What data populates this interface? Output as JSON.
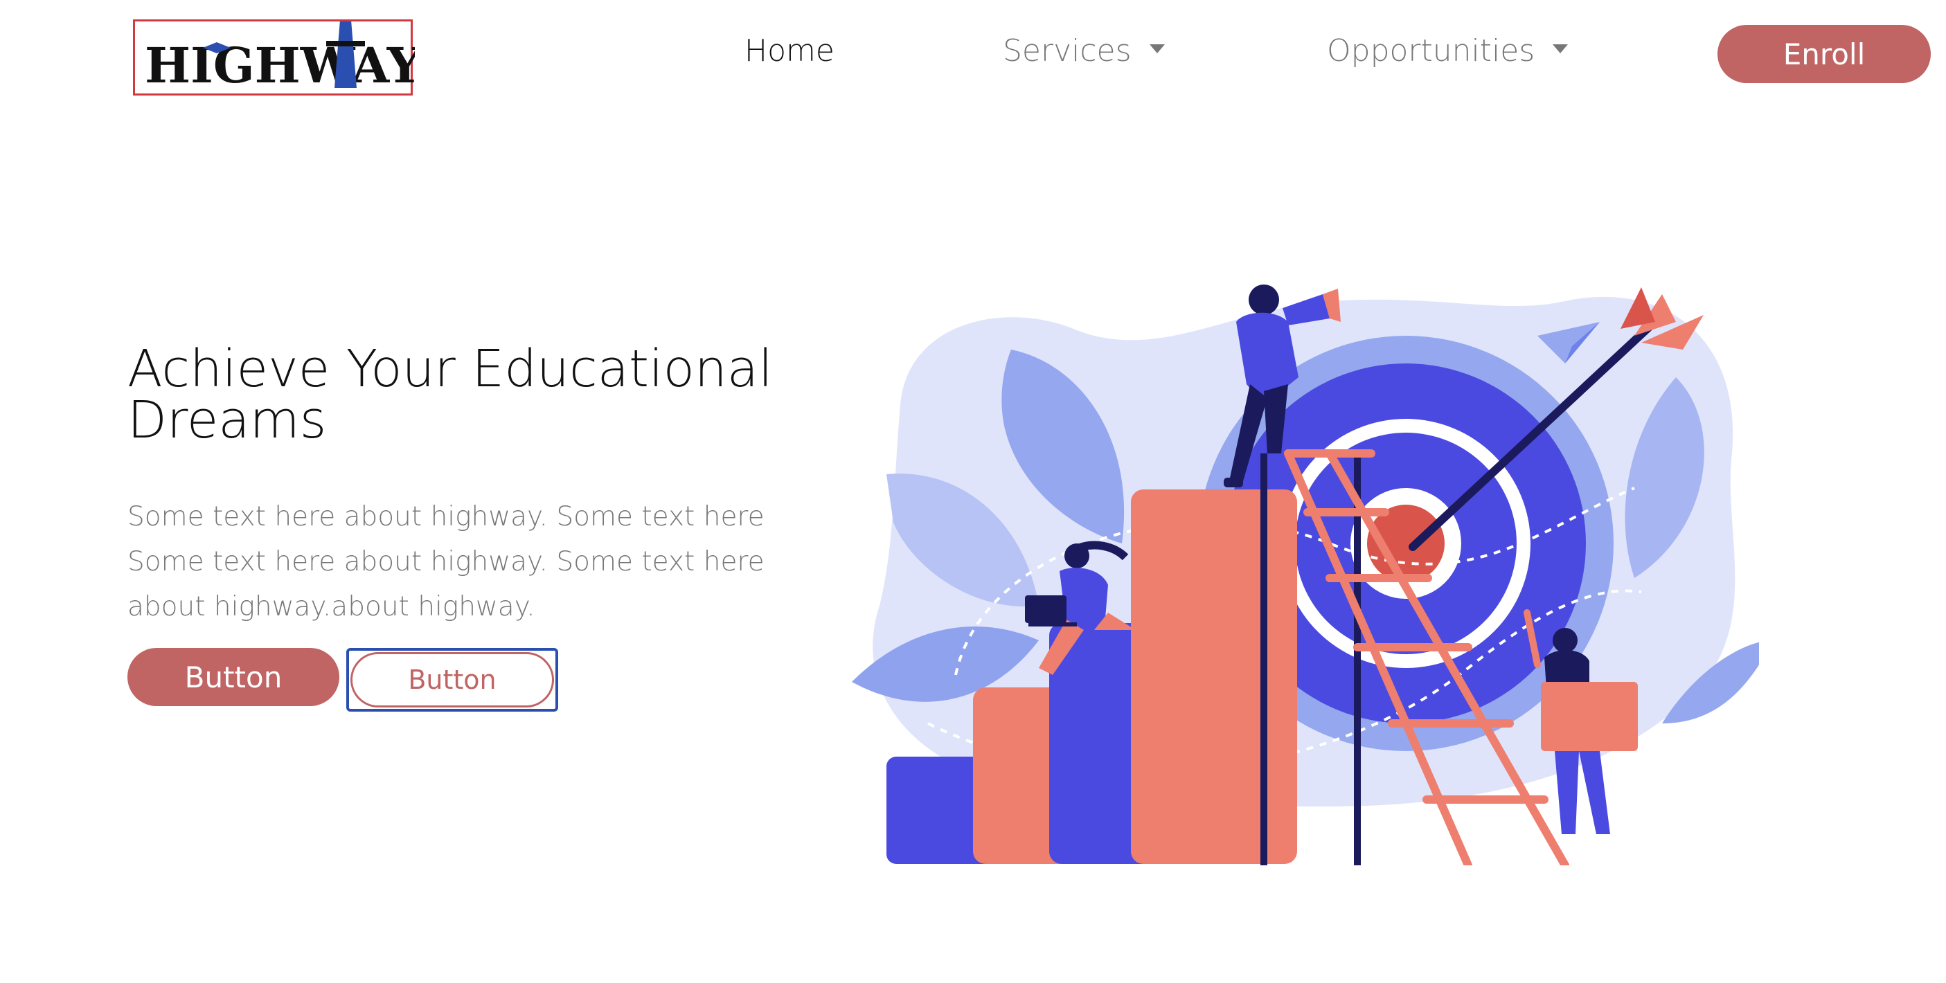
{
  "header": {
    "logo_text": "HIGHWAY",
    "nav": [
      {
        "label": "Home",
        "active": true,
        "has_dropdown": false
      },
      {
        "label": "Services",
        "active": false,
        "has_dropdown": true
      },
      {
        "label": "Opportunities",
        "active": false,
        "has_dropdown": true
      }
    ],
    "enroll_label": "Enroll"
  },
  "hero": {
    "title_line1": "Achieve Your Educational",
    "title_line2": "Dreams",
    "text_line1": "Some text here about highway. Some text here",
    "text_line2": "Some text here about highway. Some text here",
    "text_line3": "about highway.about highway.",
    "primary_button": "Button",
    "secondary_button": "Button"
  },
  "illustration": {
    "icon": "goal-achievement-illustration"
  },
  "colors": {
    "brand": "#c06464",
    "accent_blue": "#4b4ae0",
    "coral": "#ee7e6e",
    "outline_blue": "#2a4fb0"
  }
}
